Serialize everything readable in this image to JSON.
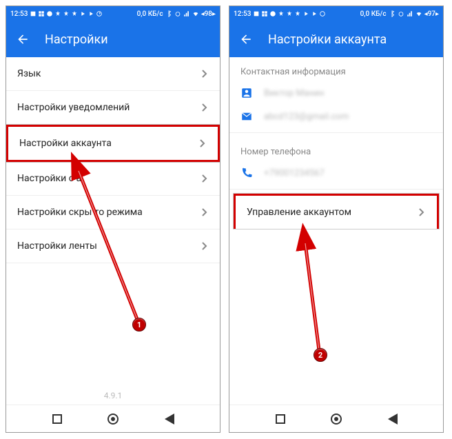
{
  "status": {
    "time": "12:53",
    "net_text": "0,0 КБ/с",
    "battery_left": "98",
    "battery_right": "97"
  },
  "left": {
    "title": "Настройки",
    "items": [
      "Язык",
      "Настройки уведомлений",
      "Настройки аккаунта",
      "Настройки с           а",
      "Настройки скры   то режима",
      "Настройки ленты"
    ],
    "version": "4.9.1",
    "marker": "1"
  },
  "right": {
    "title": "Настройки аккаунта",
    "section_contact": "Контактная информация",
    "contact_name": "Виктор Манин",
    "contact_email": "abcd123@gmail.com",
    "section_phone": "Номер телефона",
    "phone": "+79001234567",
    "manage": "Управление аккаунтом",
    "marker": "2"
  }
}
